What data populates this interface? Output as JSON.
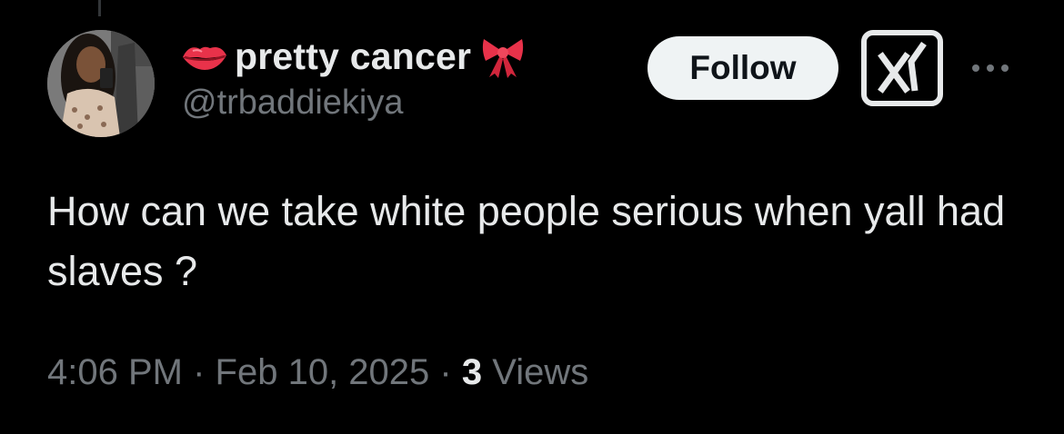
{
  "colors": {
    "background": "#000000",
    "primary_text": "#e7e9ea",
    "secondary_text": "#71767b",
    "follow_bg": "#eff3f4",
    "follow_text": "#0f1419",
    "emoji_red": "#e8324a"
  },
  "author": {
    "display_name": "pretty cancer",
    "handle": "@trbaddiekiya",
    "name_prefix_icon": "kiss-mark-icon",
    "name_suffix_icon": "ribbon-icon"
  },
  "actions": {
    "follow_label": "Follow",
    "grok_icon": "grok-icon",
    "more_icon": "more-icon"
  },
  "tweet": {
    "text": "How can we take white people serious when yall had slaves ?"
  },
  "meta": {
    "time": "4:06 PM",
    "separator": "·",
    "date": "Feb 10, 2025",
    "views_count": "3",
    "views_label": "Views"
  }
}
